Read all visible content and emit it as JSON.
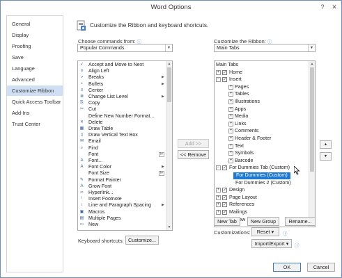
{
  "window": {
    "title": "Word Options",
    "help_icon": "help-icon",
    "close_icon": "close-icon"
  },
  "nav": {
    "items": [
      {
        "label": "General",
        "selected": false
      },
      {
        "label": "Display",
        "selected": false
      },
      {
        "label": "Proofing",
        "selected": false
      },
      {
        "label": "Save",
        "selected": false
      },
      {
        "label": "Language",
        "selected": false
      },
      {
        "label": "Advanced",
        "selected": false
      },
      {
        "label": "Customize Ribbon",
        "selected": true
      },
      {
        "label": "Quick Access Toolbar",
        "selected": false
      },
      {
        "label": "Add-Ins",
        "selected": false
      },
      {
        "label": "Trust Center",
        "selected": false
      }
    ]
  },
  "header": {
    "text": "Customize the Ribbon and keyboard shortcuts."
  },
  "left": {
    "choose_label": "Choose commands from:",
    "choose_value": "Popular Commands",
    "commands": [
      {
        "label": "Accept and Move to Next",
        "icon": "accept-icon",
        "sub": false
      },
      {
        "label": "Align Left",
        "icon": "align-left-icon",
        "sub": false
      },
      {
        "label": "Breaks",
        "icon": "breaks-icon",
        "sub": true
      },
      {
        "label": "Bullets",
        "icon": "bullets-icon",
        "sub": true
      },
      {
        "label": "Center",
        "icon": "center-icon",
        "sub": false
      },
      {
        "label": "Change List Level",
        "icon": "list-level-icon",
        "sub": true
      },
      {
        "label": "Copy",
        "icon": "copy-icon",
        "sub": false
      },
      {
        "label": "Cut",
        "icon": "cut-icon",
        "sub": false
      },
      {
        "label": "Define New Number Format...",
        "icon": "",
        "sub": false
      },
      {
        "label": "Delete",
        "icon": "delete-icon",
        "sub": false
      },
      {
        "label": "Draw Table",
        "icon": "draw-table-icon",
        "sub": false
      },
      {
        "label": "Draw Vertical Text Box",
        "icon": "text-box-icon",
        "sub": false
      },
      {
        "label": "Email",
        "icon": "email-icon",
        "sub": false
      },
      {
        "label": "Find",
        "icon": "find-icon",
        "sub": false
      },
      {
        "label": "Font",
        "icon": "",
        "sub": false,
        "control": true
      },
      {
        "label": "Font...",
        "icon": "font-dialog-icon",
        "sub": false
      },
      {
        "label": "Font Color",
        "icon": "font-color-icon",
        "sub": true
      },
      {
        "label": "Font Size",
        "icon": "",
        "sub": false,
        "control": true
      },
      {
        "label": "Format Painter",
        "icon": "format-painter-icon",
        "sub": false
      },
      {
        "label": "Grow Font",
        "icon": "grow-font-icon",
        "sub": false
      },
      {
        "label": "Hyperlink...",
        "icon": "hyperlink-icon",
        "sub": false
      },
      {
        "label": "Insert Footnote",
        "icon": "footnote-icon",
        "sub": false
      },
      {
        "label": "Line and Paragraph Spacing",
        "icon": "line-spacing-icon",
        "sub": true
      },
      {
        "label": "Macros",
        "icon": "macros-icon",
        "sub": false
      },
      {
        "label": "Multiple Pages",
        "icon": "multiple-pages-icon",
        "sub": false
      },
      {
        "label": "New",
        "icon": "new-icon",
        "sub": false
      }
    ],
    "keyboard_label": "Keyboard shortcuts:",
    "customize_button": "Customize..."
  },
  "middle": {
    "add_button": "Add >>",
    "remove_button": "<< Remove"
  },
  "right": {
    "customize_label": "Customize the Ribbon:",
    "customize_value": "Main Tabs",
    "tree": [
      {
        "label": "Main Tabs",
        "level": 0,
        "expander": "",
        "checked": null,
        "header": true
      },
      {
        "label": "Home",
        "level": 0,
        "expander": "+",
        "checked": true
      },
      {
        "label": "Insert",
        "level": 0,
        "expander": "−",
        "checked": true
      },
      {
        "label": "Pages",
        "level": 1,
        "expander": "+",
        "checked": null
      },
      {
        "label": "Tables",
        "level": 1,
        "expander": "+",
        "checked": null
      },
      {
        "label": "Illustrations",
        "level": 1,
        "expander": "+",
        "checked": null
      },
      {
        "label": "Apps",
        "level": 1,
        "expander": "+",
        "checked": null
      },
      {
        "label": "Media",
        "level": 1,
        "expander": "+",
        "checked": null
      },
      {
        "label": "Links",
        "level": 1,
        "expander": "+",
        "checked": null
      },
      {
        "label": "Comments",
        "level": 1,
        "expander": "+",
        "checked": null
      },
      {
        "label": "Header & Footer",
        "level": 1,
        "expander": "+",
        "checked": null
      },
      {
        "label": "Text",
        "level": 1,
        "expander": "+",
        "checked": null
      },
      {
        "label": "Symbols",
        "level": 1,
        "expander": "+",
        "checked": null
      },
      {
        "label": "Barcode",
        "level": 1,
        "expander": "+",
        "checked": null
      },
      {
        "label": "For Dummies Tab (Custom)",
        "level": 0,
        "expander": "−",
        "checked": true
      },
      {
        "label": "For Dummies (Custom)",
        "level": 1,
        "expander": "",
        "checked": null,
        "selected": true
      },
      {
        "label": "For Dummies 2 (Custom)",
        "level": 1,
        "expander": "",
        "checked": null
      },
      {
        "label": "Design",
        "level": 0,
        "expander": "+",
        "checked": true
      },
      {
        "label": "Page Layout",
        "level": 0,
        "expander": "+",
        "checked": true
      },
      {
        "label": "References",
        "level": 0,
        "expander": "+",
        "checked": true
      },
      {
        "label": "Mailings",
        "level": 0,
        "expander": "+",
        "checked": true
      },
      {
        "label": "Review",
        "level": 0,
        "expander": "+",
        "checked": true
      }
    ],
    "new_tab_button": "New Tab",
    "new_group_button": "New Group",
    "rename_button": "Rename...",
    "customizations_label": "Customizations:",
    "reset_button": "Reset ▾",
    "import_export_button": "Import/Export ▾"
  },
  "footer": {
    "ok_button": "OK",
    "cancel_button": "Cancel"
  },
  "colors": {
    "accent": "#1c7ad6",
    "nav_selected": "#cfe0f4"
  }
}
